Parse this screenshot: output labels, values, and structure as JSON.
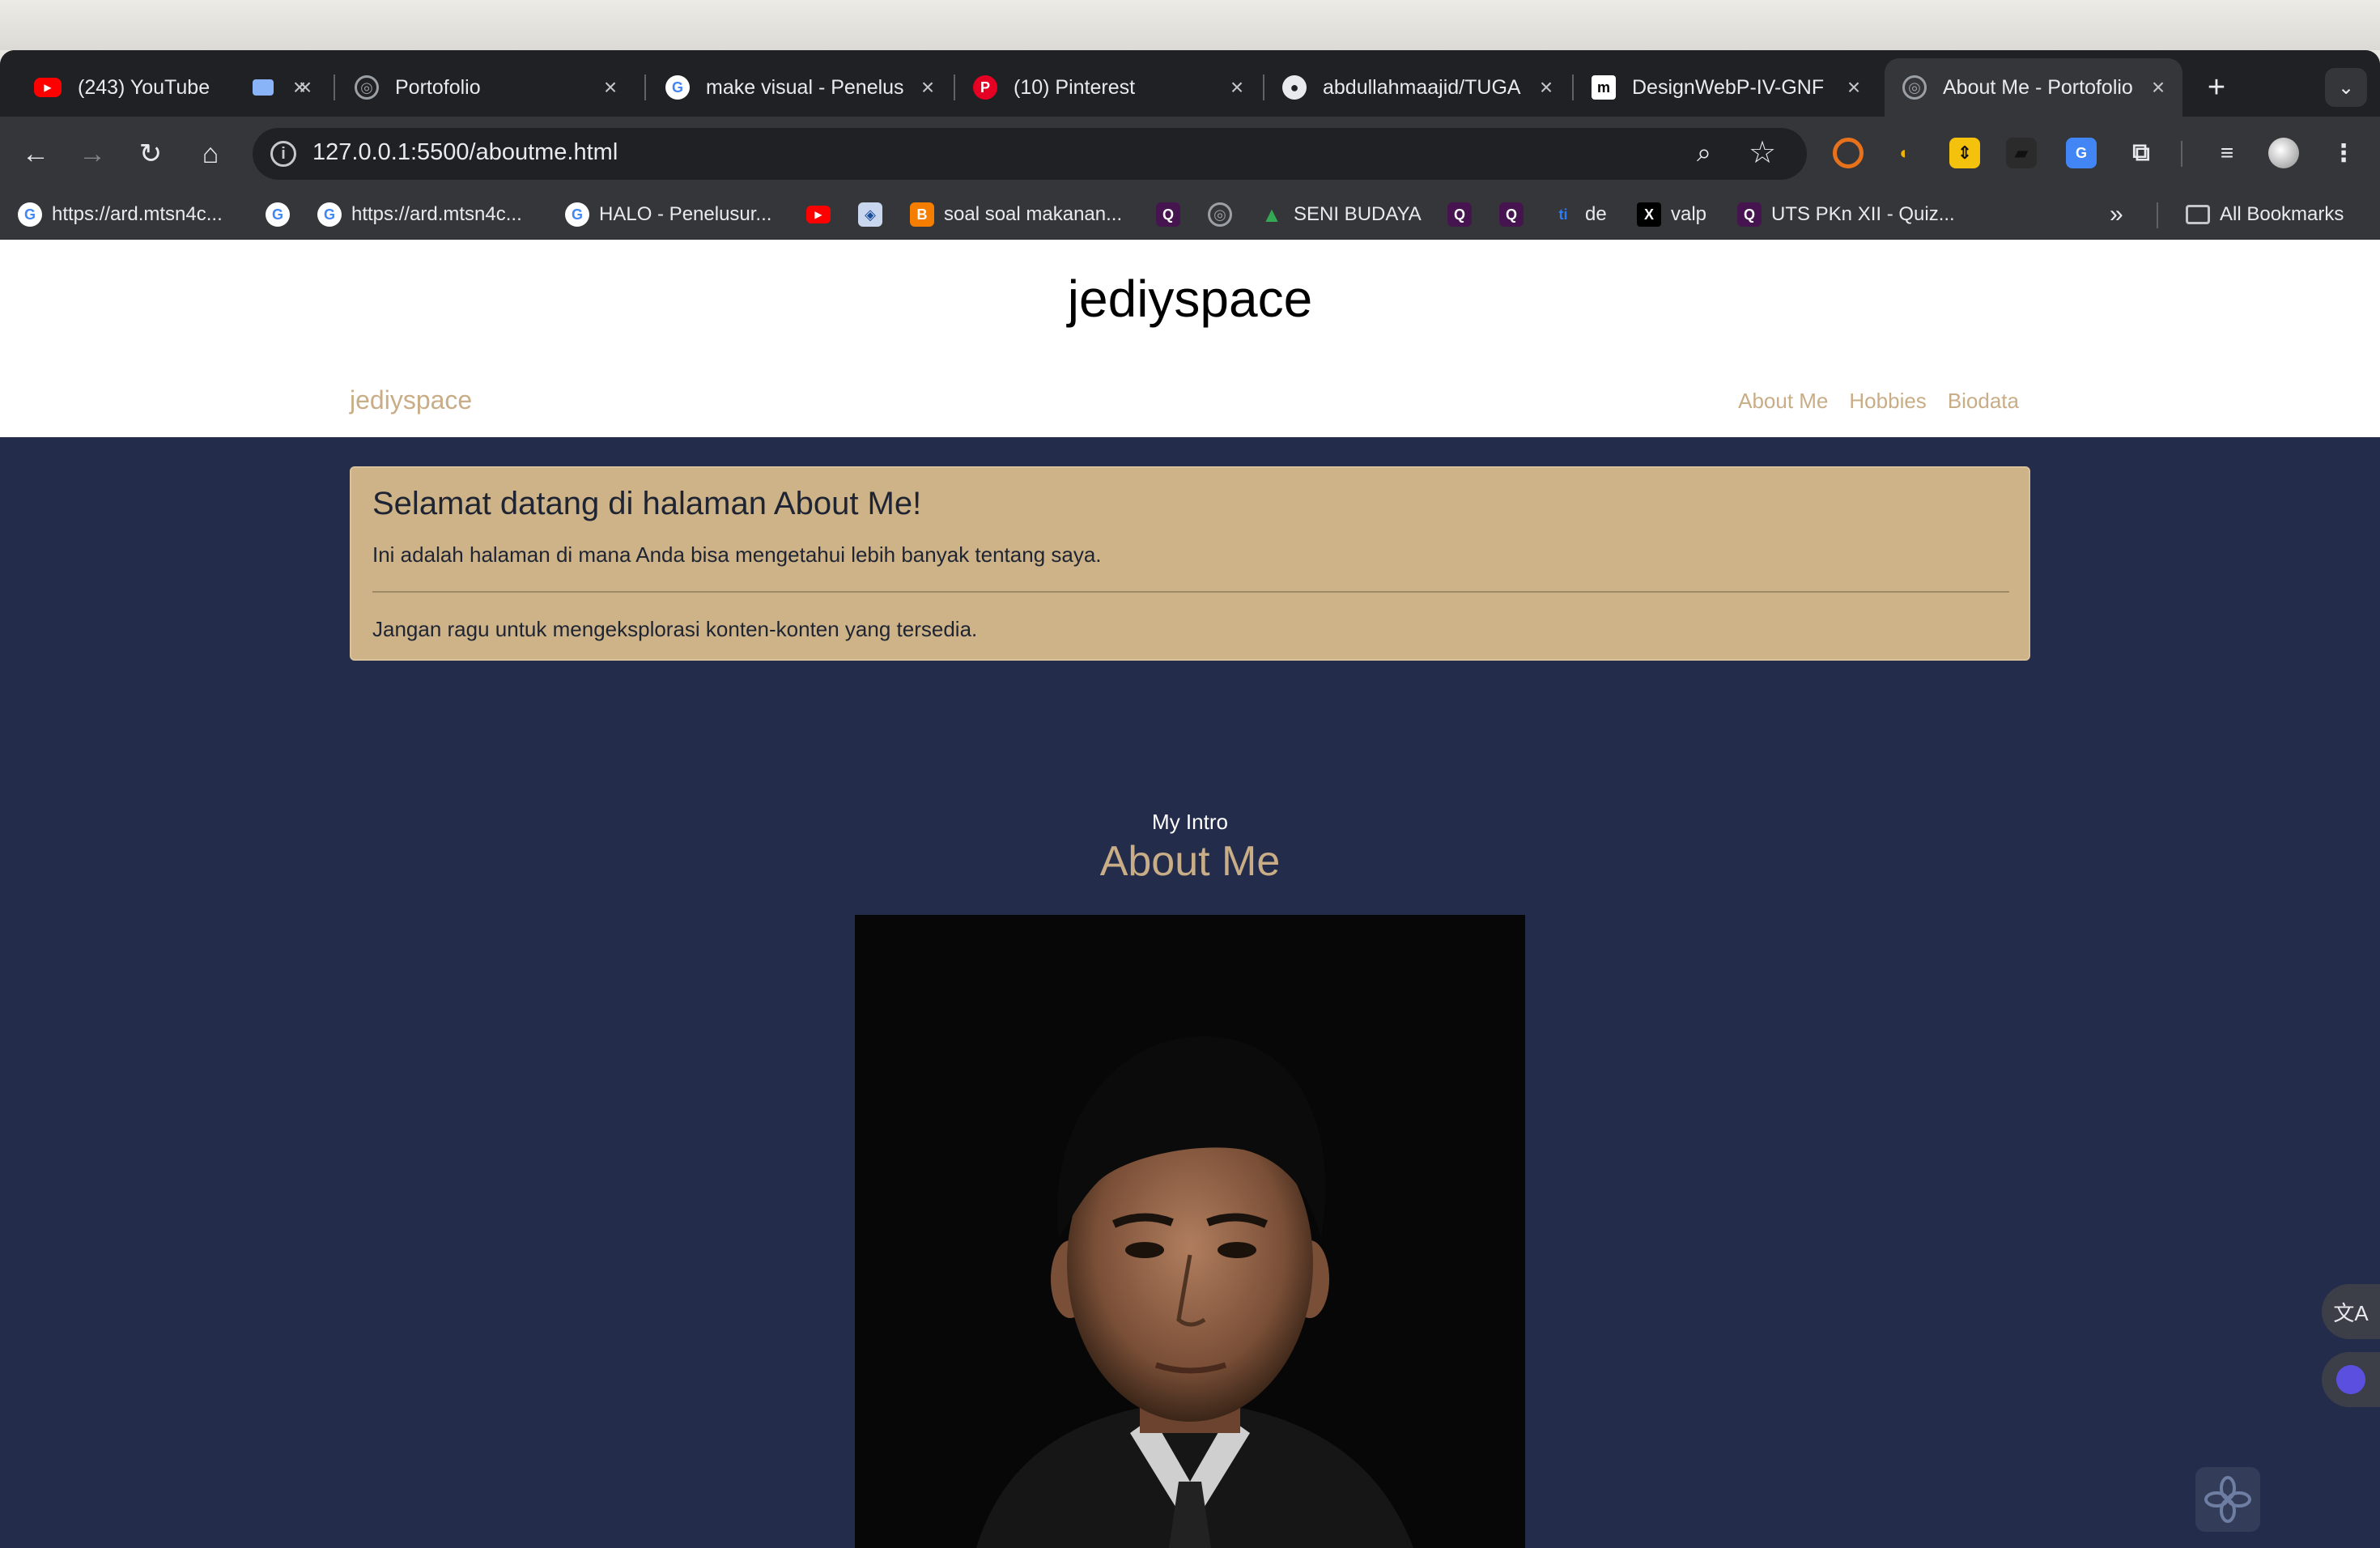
{
  "tabs": [
    {
      "title": "(243) YouTube",
      "icon": "youtube-icon"
    },
    {
      "title": "",
      "icon": "screen-icon"
    },
    {
      "title": "Portofolio",
      "icon": "globe-icon"
    },
    {
      "title": "make visual - Penelus",
      "icon": "google-icon"
    },
    {
      "title": "(10) Pinterest",
      "icon": "pinterest-icon"
    },
    {
      "title": "abdullahmaajid/TUGA",
      "icon": "github-icon"
    },
    {
      "title": "DesignWebP-IV-GNF",
      "icon": "medium-icon"
    },
    {
      "title": "About Me - Portofolio",
      "icon": "globe-icon",
      "active": true
    }
  ],
  "toolbar": {
    "url": "127.0.0.1:5500/aboutme.html"
  },
  "bookmarks": [
    {
      "label": "https://ard.mtsn4c...",
      "icon": "google-icon"
    },
    {
      "label": "",
      "icon": "google-icon"
    },
    {
      "label": "https://ard.mtsn4c...",
      "icon": "google-icon"
    },
    {
      "label": "HALO - Penelusur...",
      "icon": "google-icon"
    },
    {
      "label": "",
      "icon": "youtube-icon"
    },
    {
      "label": "",
      "icon": "app-icon"
    },
    {
      "label": "soal soal makanan...",
      "icon": "blogger-icon"
    },
    {
      "label": "",
      "icon": "quizizz-icon"
    },
    {
      "label": "",
      "icon": "globe-icon"
    },
    {
      "label": "SENI BUDAYA",
      "icon": "drive-icon"
    },
    {
      "label": "",
      "icon": "quizizz-icon"
    },
    {
      "label": "",
      "icon": "quizizz-icon"
    },
    {
      "label": "de",
      "icon": "ti-icon"
    },
    {
      "label": "valp",
      "icon": "x-icon"
    },
    {
      "label": "UTS PKn XII - Quiz...",
      "icon": "quizizz-icon"
    }
  ],
  "bookmarks_overflow": "»",
  "all_bookmarks": "All Bookmarks",
  "site": {
    "title": "jediyspace",
    "brand": "jediyspace",
    "nav": [
      "About Me",
      "Hobbies",
      "Biodata"
    ]
  },
  "alert": {
    "heading": "Selamat datang di halaman About Me!",
    "text1": "Ini adalah halaman di mana Anda bisa mengetahui lebih banyak tentang saya.",
    "text2": "Jangan ragu untuk mengeksplorasi konten-konten yang tersedia."
  },
  "intro": {
    "small": "My Intro",
    "title": "About Me"
  },
  "colors": {
    "page_bg": "#232c4a",
    "accent": "#c8ad86",
    "alert_bg": "#cdb387"
  }
}
